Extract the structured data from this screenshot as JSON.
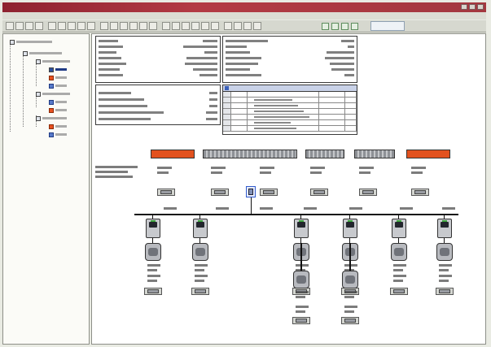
{
  "window": {
    "title": ""
  },
  "menu": {
    "items": [
      "",
      "",
      "",
      "",
      "",
      "",
      "",
      "",
      ""
    ]
  },
  "toolbar": {
    "button_count": 25
  },
  "tree": {
    "nodes": [
      {
        "icon": "project-icon",
        "selected": false
      },
      {
        "icon": "plant-icon",
        "selected": false
      },
      {
        "icon": "drive-group-icon",
        "selected": false
      },
      {
        "icon": "drive-icon",
        "selected": true
      },
      {
        "icon": "drive-icon",
        "selected": false
      },
      {
        "icon": "drive-icon",
        "selected": false
      },
      {
        "icon": "drive-group-icon",
        "selected": false
      },
      {
        "icon": "drive-icon",
        "selected": false
      },
      {
        "icon": "drive-icon",
        "selected": false
      },
      {
        "icon": "drive-group-icon",
        "selected": false
      },
      {
        "icon": "drive-icon",
        "selected": false
      },
      {
        "icon": "drive-icon",
        "selected": false
      }
    ]
  },
  "panels": {
    "info_left_rows": 7,
    "info_right_rows": 7,
    "params_rows": 5,
    "grid_title": "",
    "grid_rows": 7
  },
  "diagram": {
    "conveyors": [
      {
        "color": "red"
      },
      {
        "color": "grey"
      },
      {
        "color": "grey"
      },
      {
        "color": "grey"
      },
      {
        "color": "red"
      }
    ],
    "drives_top_row": 6,
    "drives_bottom_row": 2
  },
  "colors": {
    "titlebar": "#a3383f",
    "conveyor_red": "#e2521f",
    "conveyor_grey": "#8e9196",
    "selection_blue": "#2a4f9f",
    "panel_bg": "#e9ebe3"
  }
}
